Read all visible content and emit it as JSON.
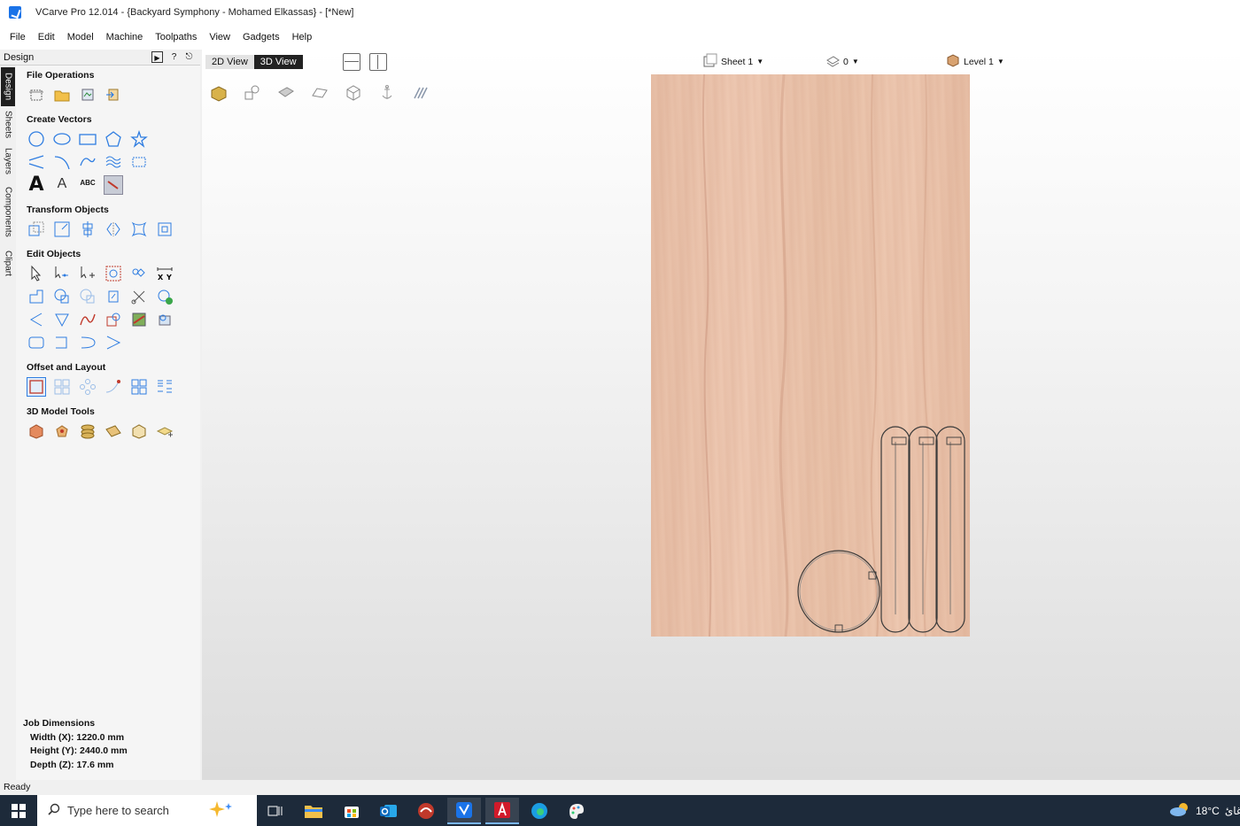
{
  "window": {
    "title": "VCarve Pro 12.014 - {Backyard Symphony - Mohamed Elkassas} - [*New]"
  },
  "menu": [
    "File",
    "Edit",
    "Model",
    "Machine",
    "Toolpaths",
    "View",
    "Gadgets",
    "Help"
  ],
  "dock": {
    "header": "Design",
    "help_label": "?",
    "tabs": [
      "Design",
      "Sheets",
      "Layers",
      "Components",
      "Clipart"
    ]
  },
  "sections": {
    "file_operations": "File Operations",
    "create_vectors": "Create Vectors",
    "transform_objects": "Transform Objects",
    "edit_objects": "Edit Objects",
    "offset_layout": "Offset and Layout",
    "model_tools": "3D Model Tools"
  },
  "create_vectors_text": {
    "big_a": "A",
    "small_a": "A",
    "abc": "ABC"
  },
  "job_dimensions": {
    "title": "Job Dimensions",
    "width": "Width  (X): 1220.0 mm",
    "height": "Height (Y): 2440.0 mm",
    "depth": "Depth  (Z): 17.6 mm"
  },
  "view": {
    "tab_2d": "2D View",
    "tab_3d": "3D View",
    "active_tab": "3D View",
    "sheet": "Sheet 1",
    "sheet_count": "0",
    "level": "Level 1"
  },
  "status": {
    "text": "Ready"
  },
  "taskbar": {
    "search_placeholder": "Type here to search",
    "temperature": "18°C",
    "weather_text": "غائ"
  },
  "colors": {
    "accent": "#1a73e8",
    "wood": "#ecc6ae",
    "taskbar": "#1d2a3a"
  }
}
